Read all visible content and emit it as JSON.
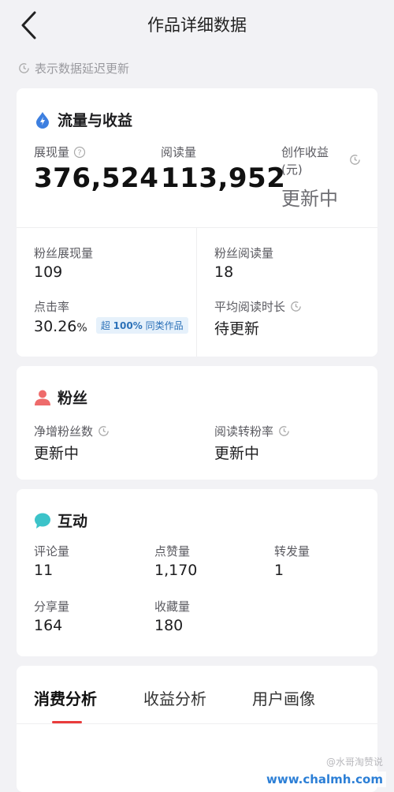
{
  "header": {
    "title": "作品详细数据"
  },
  "notice": {
    "text": "表示数据延迟更新"
  },
  "traffic": {
    "title": "流量与收益",
    "impressions": {
      "label": "展现量",
      "value": "376,524"
    },
    "reads": {
      "label": "阅读量",
      "value": "113,952"
    },
    "earnings": {
      "label_line1": "创作收益",
      "label_line2": "(元)",
      "value": "更新中"
    },
    "fan_impressions": {
      "label": "粉丝展现量",
      "value": "109"
    },
    "fan_reads": {
      "label": "粉丝阅读量",
      "value": "18"
    },
    "ctr": {
      "label": "点击率",
      "value": "30.26",
      "unit": "%",
      "badge_prefix": "超",
      "badge_pct": "100%",
      "badge_suffix": "同类作品"
    },
    "avg_read_time": {
      "label": "平均阅读时长",
      "value": "待更新"
    }
  },
  "fans": {
    "title": "粉丝",
    "net_new": {
      "label": "净增粉丝数",
      "value": "更新中"
    },
    "conversion": {
      "label": "阅读转粉率",
      "value": "更新中"
    }
  },
  "interaction": {
    "title": "互动",
    "comments": {
      "label": "评论量",
      "value": "11"
    },
    "likes": {
      "label": "点赞量",
      "value": "1,170"
    },
    "reposts": {
      "label": "转发量",
      "value": "1"
    },
    "shares": {
      "label": "分享量",
      "value": "164"
    },
    "favorites": {
      "label": "收藏量",
      "value": "180"
    }
  },
  "tabs": [
    {
      "label": "消费分析"
    },
    {
      "label": "收益分析"
    },
    {
      "label": "用户画像"
    }
  ],
  "watermark": {
    "source": "@水哥淘赞说",
    "site": "www.chalmh.com"
  },
  "colors": {
    "accent_red": "#e93c3c",
    "badge_blue": "#2d72b9",
    "icon_blue": "#3d7fe0",
    "icon_pink": "#ee6b6b",
    "icon_teal": "#3cc3c9"
  }
}
